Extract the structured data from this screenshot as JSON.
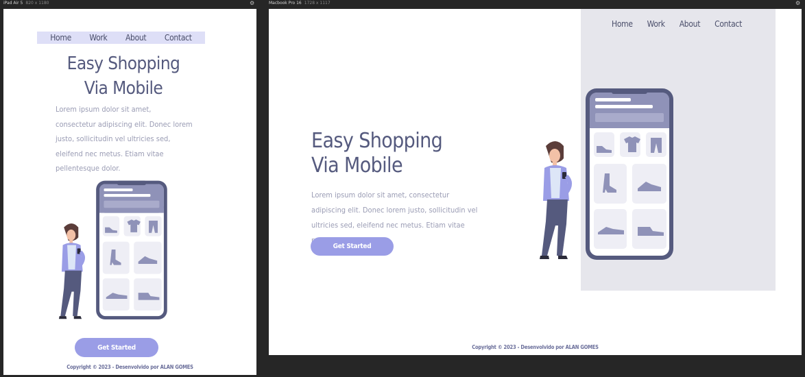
{
  "devices": [
    {
      "label": "iPad Air 5",
      "dims": "820 x 1180",
      "nav": [
        "Home",
        "Work",
        "About",
        "Contact"
      ],
      "title_line1": "Easy Shopping",
      "title_line2": "Via Mobile",
      "text": "Lorem ipsum dolor sit amet, consectetur adipiscing elit. Donec lorem justo, sollicitudin vel ultricies sed, eleifend nec metus. Etiam vitae pellentesque dolor.",
      "button": "Get Started",
      "copyright": "Copyright © 2023 - Desenvolvido por ALAN GOMES"
    },
    {
      "label": "Macbook Pro 16",
      "dims": "1728 x 1117",
      "nav": [
        "Home",
        "Work",
        "About",
        "Contact"
      ],
      "title_line1": "Easy Shopping",
      "title_line2": "Via Mobile",
      "text": "Lorem ipsum dolor sit amet, consectetur adipiscing elit. Donec lorem justo, sollicitudin vel ultricies sed, eleifend nec metus. Etiam vitae pellentesque dolor.",
      "button": "Get Started",
      "copyright": "Copyright © 2023 - Desenvolvido por ALAN GOMES"
    }
  ],
  "icons": {
    "settings": "gear-icon",
    "illustration": "shopping-app-illustration"
  },
  "colors": {
    "background": "#262626",
    "nav_bar": "#dedff7",
    "title": "#555a7e",
    "body_text": "#9a9cb4",
    "button": "#9a9de6",
    "panel": "#e6e6ec",
    "phone": "#555a7e",
    "jacket": "#9a9de6",
    "copyright": "#6a6e9a"
  }
}
